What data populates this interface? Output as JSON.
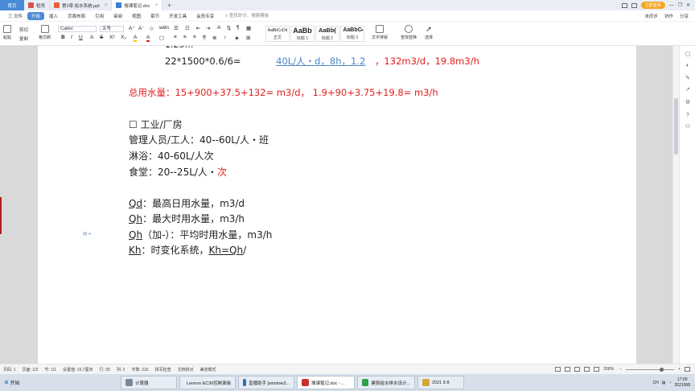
{
  "tabs": {
    "home": "首页",
    "items": [
      {
        "label": "稻壳",
        "color": "#d9534f"
      },
      {
        "label": "第2章 给水系统.ppt",
        "color": "#e8603c"
      },
      {
        "label": "搜课笔记.doc",
        "color": "#3a7bd5"
      }
    ],
    "login": "立即登录"
  },
  "menu": {
    "file": "三 文件",
    "items": [
      "开始",
      "插入",
      "页面布局",
      "引用",
      "审阅",
      "视图",
      "章节",
      "开发工具",
      "会员专享"
    ],
    "search": "查找命令、搜索模板",
    "right": [
      "未同步",
      "协作",
      "分享"
    ]
  },
  "ribbon": {
    "paste": "粘贴",
    "cut": "剪切",
    "copy": "复制",
    "format_painter": "格式刷",
    "font_name": "Calibri",
    "font_size": "五号",
    "styles": [
      {
        "preview": "AaBbCcDd",
        "label": "正文"
      },
      {
        "preview": "AaBb",
        "label": "标题 1"
      },
      {
        "preview": "AaBb(",
        "label": "标题 2"
      },
      {
        "preview": "AaBbC",
        "label": "标题 3"
      }
    ],
    "text_layout": "文字排版",
    "find_replace": "查找替换",
    "select": "选择"
  },
  "document": {
    "line0": "22*1500*0.6/6=",
    "line0_blue": "40L/人・d，8h，1.2",
    "line0_red": "，132m3/d，19.8m3/h",
    "total_line": "总用水量：15+900+37.5+132=      m3/d，   1.9+90+3.75+19.8=     m3/h",
    "section_header": "☐  工业/厂房",
    "mgmt": "管理人员/工人：40--60L/人・班",
    "shower": "淋浴：40-60L/人次",
    "canteen": "食堂：20--25L/人・",
    "canteen_red": "次",
    "qd_label": "Qd",
    "qd_text": "：最高日用水量，m3/d",
    "qh_label": "Qh",
    "qh_text": "：最大时用水量，m3/h",
    "qh2_label": "Qh",
    "qh2_text": "（加-）：平均时用水量，m3/h",
    "kh_label": "Kh",
    "kh_text": "：时变化系统，",
    "kh_formula": "Kh=Qh",
    "kh_tail": "/"
  },
  "statusbar": {
    "items": [
      "页码: 1",
      "页面: 1/2",
      "节: 1/1",
      "设置值: 15.7厘米",
      "行: 25",
      "列: 2",
      "字数: 215",
      "拼写检查",
      "文档校对",
      "兼容模式"
    ],
    "zoom": "208%"
  },
  "taskbar": {
    "start": "开始",
    "items": [
      {
        "label": "计算器",
        "color": "#7a8794"
      },
      {
        "label": "Lenovo EC30控制面板",
        "color": "#2b5fb8"
      },
      {
        "label": "直播助手 [window3...",
        "color": "#2f6db5"
      },
      {
        "label": "搜课笔记.doc - ...",
        "color": "#c8302c"
      },
      {
        "label": "建筑给水排水设计...",
        "color": "#2ea14b"
      },
      {
        "label": "2021 8 8",
        "color": "#d8a636"
      }
    ],
    "lang": "CH",
    "time": "17:00",
    "date": "2021/8/8"
  }
}
